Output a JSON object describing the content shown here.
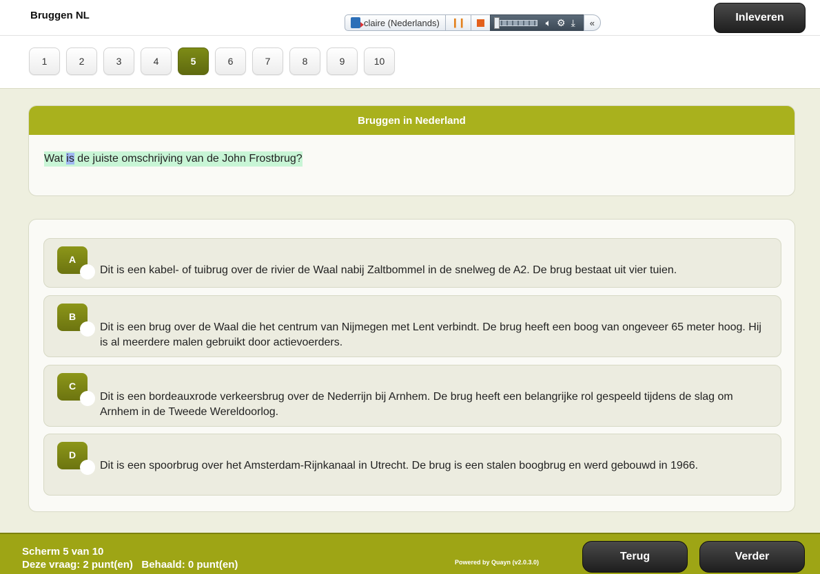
{
  "header": {
    "app_title": "Bruggen NL",
    "tts": {
      "voice_label": "claire (Nederlands)",
      "icons": [
        "speaker-icon",
        "pause-icon",
        "stop-icon",
        "volume-icon",
        "gear-icon",
        "download-icon",
        "collapse-icon"
      ],
      "collapse_glyph": "«"
    },
    "submit_label": "Inleveren"
  },
  "pager": {
    "pages": [
      "1",
      "2",
      "3",
      "4",
      "5",
      "6",
      "7",
      "8",
      "9",
      "10"
    ],
    "active": "5"
  },
  "question": {
    "title": "Bruggen in Nederland",
    "text_before": "Wat ",
    "text_highlight": "is",
    "text_after": " de juiste omschrijving van de John Frostbrug?"
  },
  "answers": [
    {
      "letter": "A",
      "text": "Dit is een kabel- of tuibrug over de rivier de Waal nabij Zaltbommel in de snelweg de A2. De brug bestaat uit vier tuien."
    },
    {
      "letter": "B",
      "text": "Dit is een brug over de Waal die het centrum van Nijmegen met Lent verbindt. De brug heeft een boog van ongeveer 65 meter hoog. Hij is al meerdere malen gebruikt door actievoerders."
    },
    {
      "letter": "C",
      "text": "Dit is een bordeauxrode verkeersbrug over de Nederrijn bij Arnhem. De brug heeft een belangrijke rol gespeeld tijdens de slag om Arnhem in de Tweede Wereldoorlog."
    },
    {
      "letter": "D",
      "text": "Dit is een spoorbrug over het Amsterdam-Rijnkanaal in Utrecht. De brug is een stalen boogbrug en werd gebouwd in 1966."
    }
  ],
  "footer": {
    "screen": "Scherm 5 van 10",
    "points": "Deze vraag: 2 punt(en)   Behaald: 0 punt(en)",
    "powered": "Powered by Quayn (v2.0.3.0)",
    "back_label": "Terug",
    "next_label": "Verder"
  },
  "colors": {
    "accent": "#a9b11d",
    "active_page": "#6c7410",
    "footer": "#9ea515",
    "background": "#eeefdf"
  }
}
